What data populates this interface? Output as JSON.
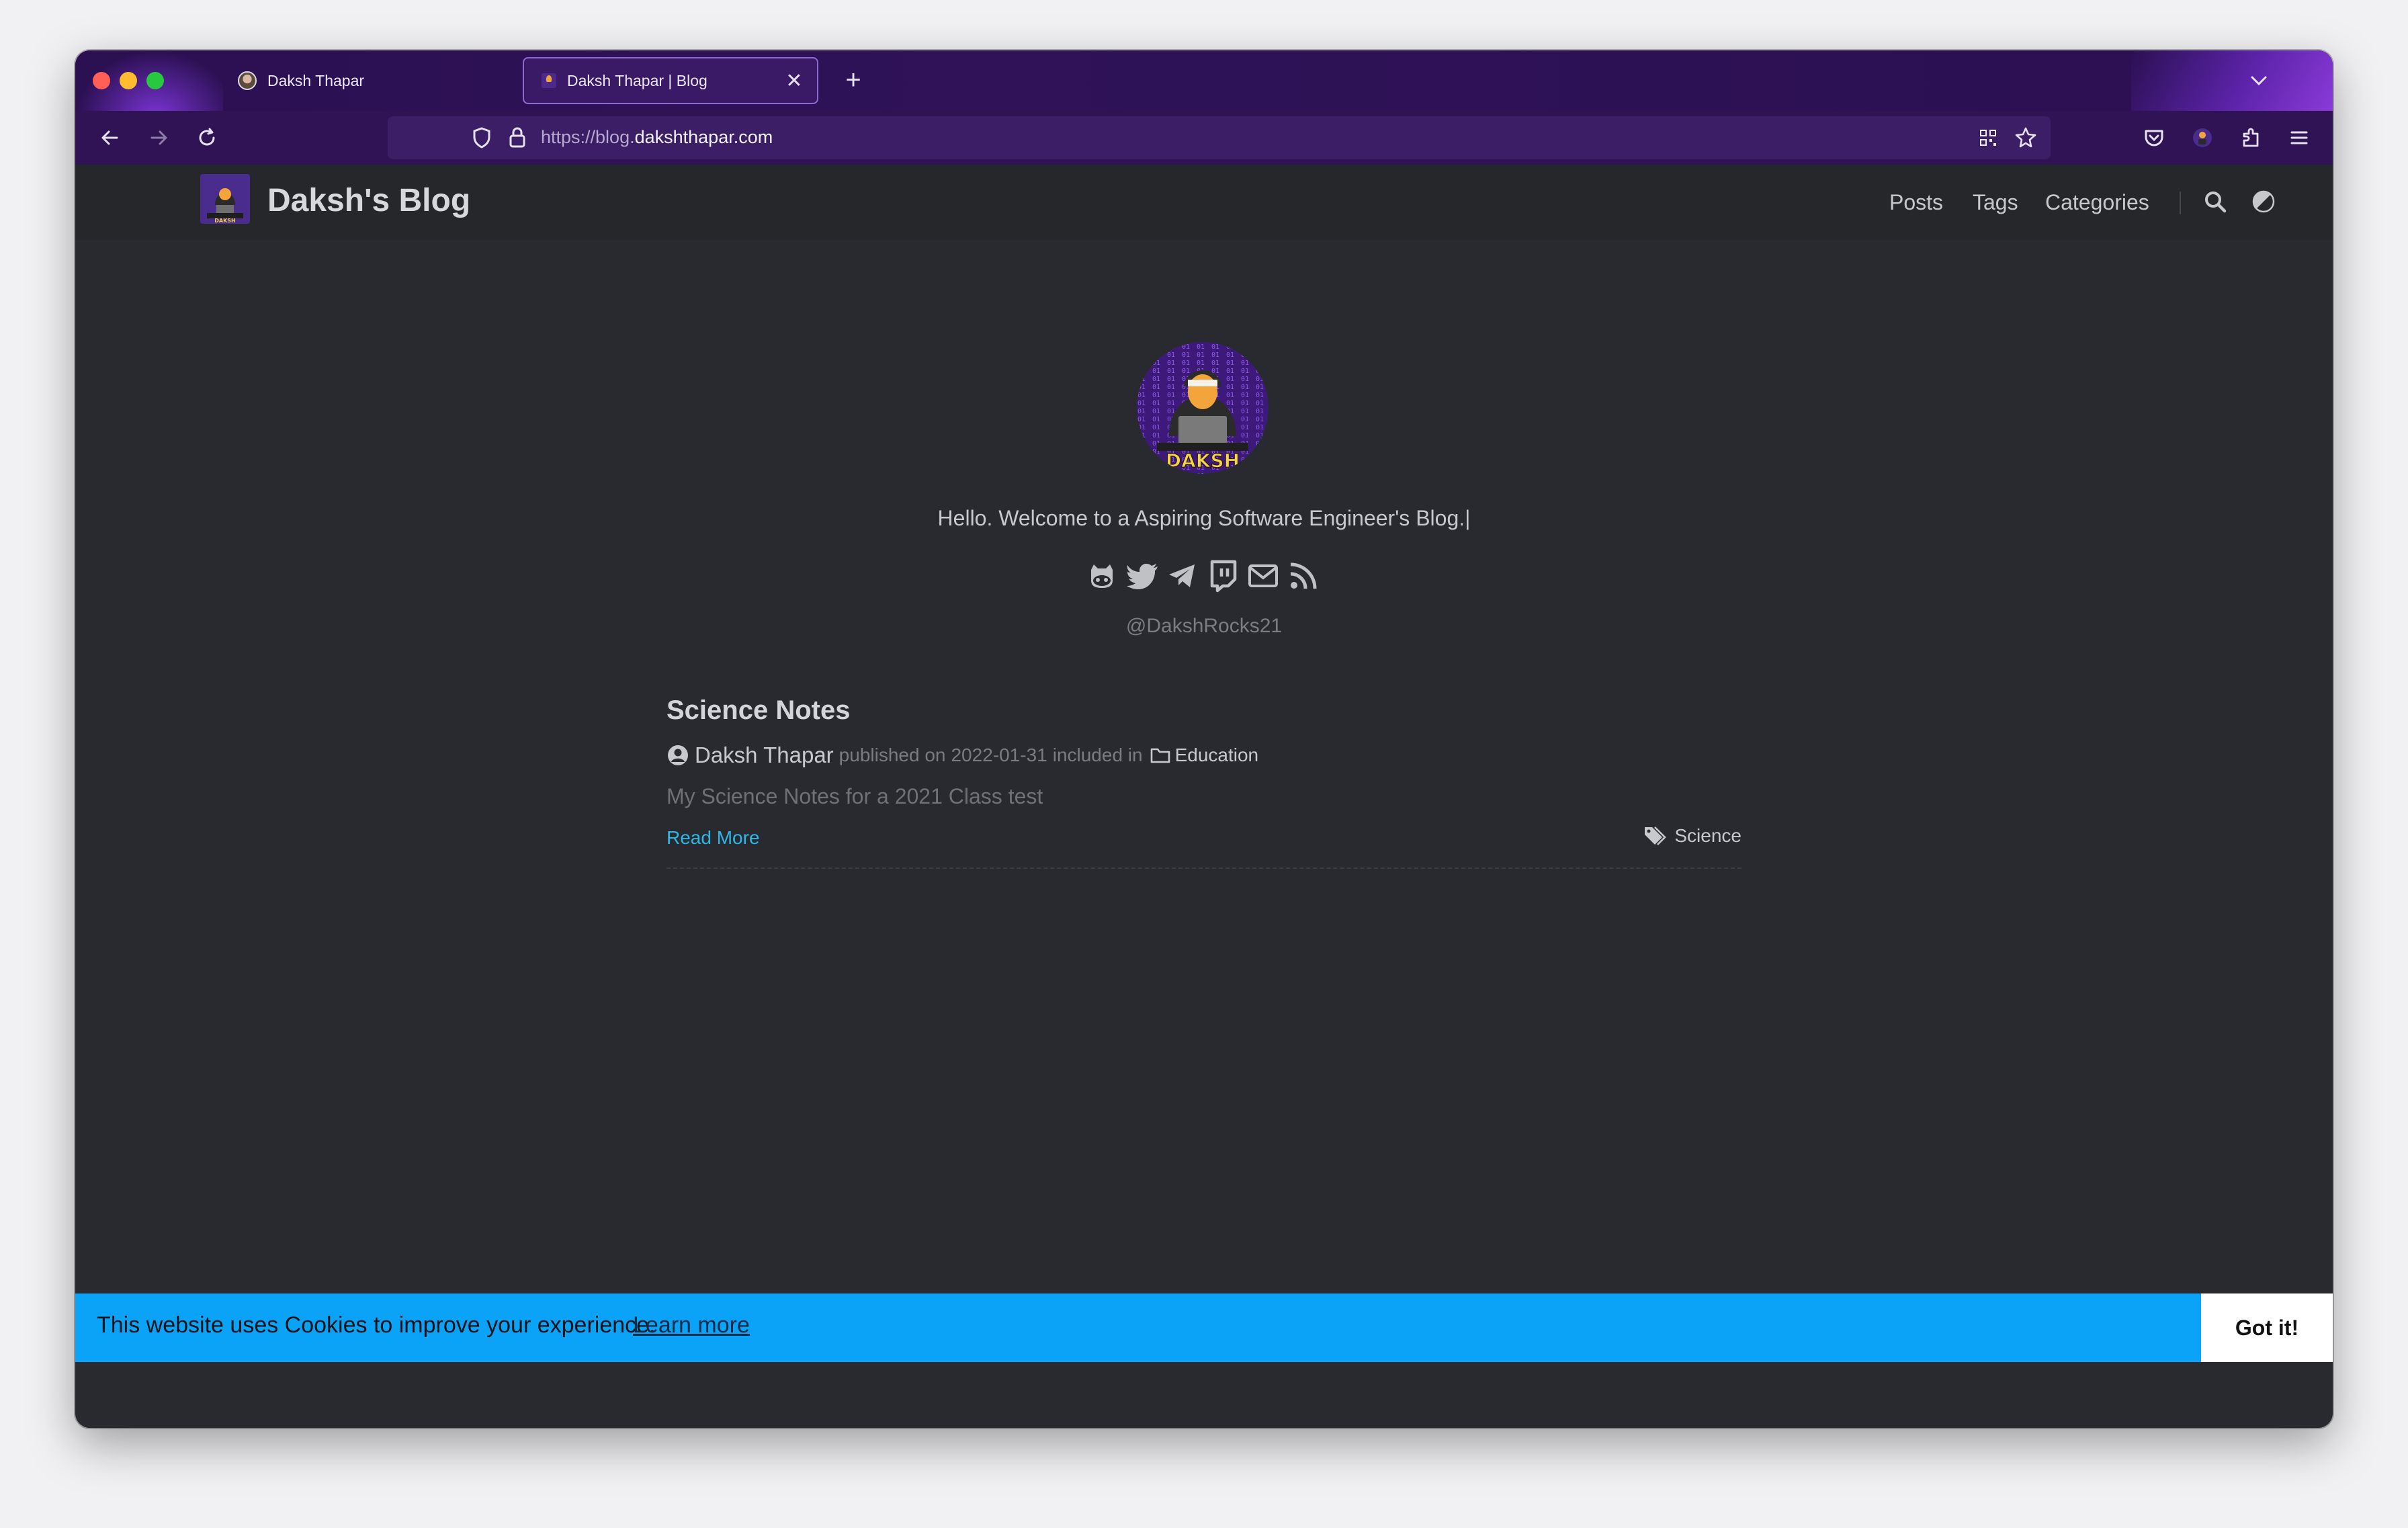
{
  "browser": {
    "tabs": [
      {
        "title": "Daksh Thapar",
        "active": false
      },
      {
        "title": "Daksh Thapar | Blog",
        "active": true
      }
    ],
    "url": {
      "prefix": "https://blog.",
      "domain": "dakshthapar.com"
    }
  },
  "site": {
    "brand": "Daksh's Blog",
    "menu": [
      {
        "label": "Posts"
      },
      {
        "label": "Tags"
      },
      {
        "label": "Categories"
      }
    ],
    "logo_text": "DAKSH"
  },
  "home": {
    "avatar_text": "DAKSH",
    "subtitle": "Hello. Welcome to a Aspiring Software Engineer's Blog.|",
    "social_icons": [
      "github-icon",
      "twitter-icon",
      "telegram-icon",
      "twitch-icon",
      "email-icon",
      "rss-icon"
    ],
    "handle": "@DakshRocks21"
  },
  "posts": [
    {
      "title": "Science Notes",
      "author": "Daksh Thapar",
      "published_prefix": "published on",
      "date": "2022-01-31",
      "included_in": "included in",
      "category": "Education",
      "summary": "My Science Notes for a 2021 Class test",
      "read_more": "Read More",
      "tag": "Science"
    }
  ],
  "cookie": {
    "message": "This website uses Cookies to improve your experience.",
    "link": "Learn more",
    "button": "Got it!",
    "color": "#0aa3f7"
  }
}
